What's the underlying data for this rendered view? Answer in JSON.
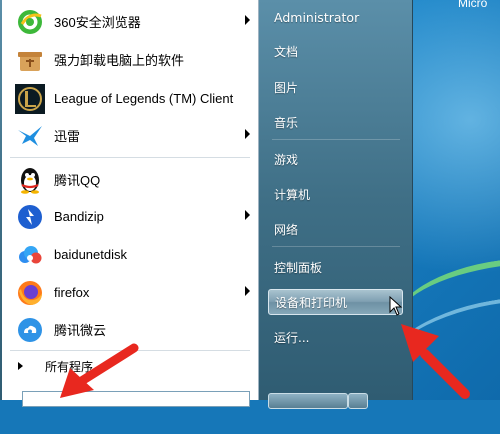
{
  "desktop": {
    "corner_text": "Micro"
  },
  "programs": [
    {
      "label": "360安全浏览器",
      "icon": "browser-360-icon",
      "submenu": true
    },
    {
      "label": "强力卸载电脑上的软件",
      "icon": "uninstaller-box-icon",
      "submenu": false
    },
    {
      "label": "League of Legends (TM) Client",
      "icon": "league-of-legends-icon",
      "submenu": false
    },
    {
      "label": "迅雷",
      "icon": "xunlei-bird-icon",
      "submenu": true
    },
    {
      "label": "腾讯QQ",
      "icon": "qq-penguin-icon",
      "submenu": false
    },
    {
      "label": "Bandizip",
      "icon": "bandizip-icon",
      "submenu": true
    },
    {
      "label": "baidunetdisk",
      "icon": "baidunetdisk-icon",
      "submenu": false
    },
    {
      "label": "firefox",
      "icon": "firefox-icon",
      "submenu": true
    },
    {
      "label": "腾讯微云",
      "icon": "weiyun-cloud-icon",
      "submenu": false
    }
  ],
  "all_programs_label": "所有程序",
  "right_pane": {
    "user": "Administrator",
    "documents": "文档",
    "pictures": "图片",
    "music": "音乐",
    "games": "游戏",
    "computer": "计算机",
    "network": "网络",
    "control_panel": "控制面板",
    "devices_printers": "设备和打印机",
    "run": "运行..."
  },
  "colors": {
    "annotation_arrow": "#e8281f",
    "hover_highlight": "#86a8b9"
  }
}
